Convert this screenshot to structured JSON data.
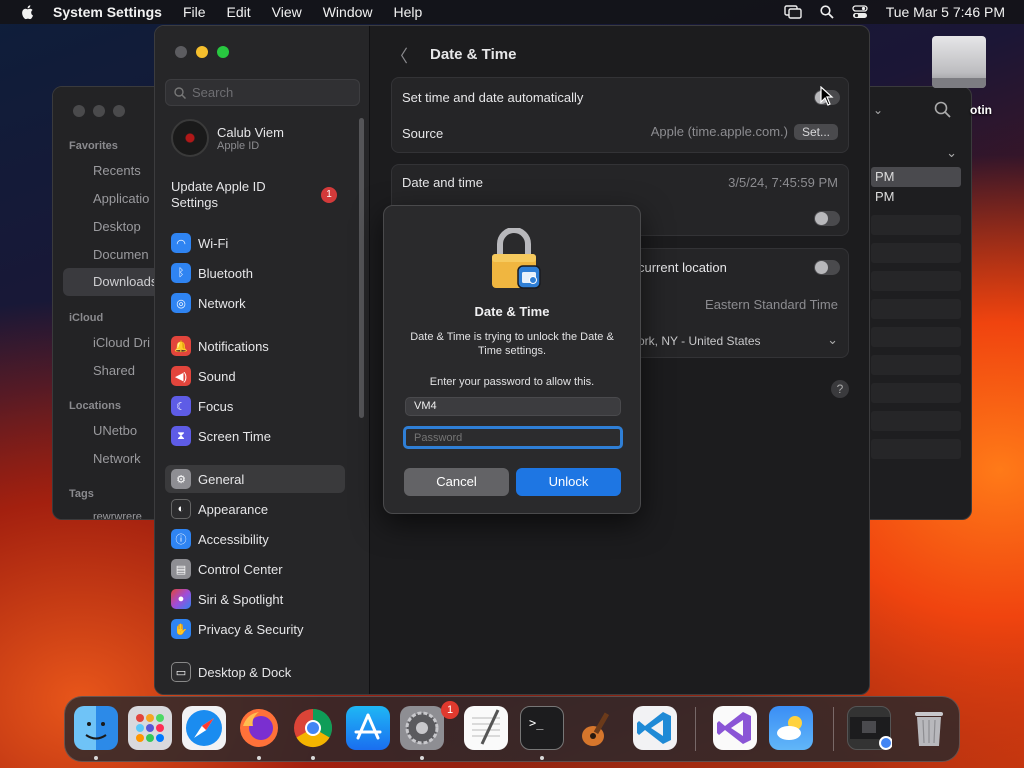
{
  "menubar": {
    "app": "System Settings",
    "menus": [
      "File",
      "Edit",
      "View",
      "Window",
      "Help"
    ],
    "clock": "Tue Mar 5  7:46 PM"
  },
  "finder": {
    "sections": [
      "Favorites",
      "iCloud",
      "Locations",
      "Tags"
    ],
    "favorites": [
      "Recents",
      "Applicatio",
      "Desktop",
      "Documen",
      "Downloads"
    ],
    "icloud": [
      "iCloud Dri",
      "Shared"
    ],
    "locations": [
      "UNetbo",
      "Network"
    ],
    "tags": [
      "rewrwrere"
    ],
    "rows": [
      "PM",
      "PM"
    ]
  },
  "desktop": {
    "drive_label": "otin"
  },
  "sidebar": {
    "search_placeholder": "Search",
    "account_name": "Calub Viem",
    "account_sub": "Apple ID",
    "update_label": "Update Apple ID Settings",
    "update_badge": "1",
    "items": [
      {
        "label": "Wi-Fi",
        "color": "#2f84f2"
      },
      {
        "label": "Bluetooth",
        "color": "#2f84f2"
      },
      {
        "label": "Network",
        "color": "#2f84f2"
      },
      {
        "label": "Notifications",
        "color": "#e2453c"
      },
      {
        "label": "Sound",
        "color": "#e2453c"
      },
      {
        "label": "Focus",
        "color": "#5e5ce6"
      },
      {
        "label": "Screen Time",
        "color": "#5e5ce6"
      },
      {
        "label": "General",
        "color": "#8e8e93"
      },
      {
        "label": "Appearance",
        "color": "#2b2b2d"
      },
      {
        "label": "Accessibility",
        "color": "#2f84f2"
      },
      {
        "label": "Control Center",
        "color": "#8e8e93"
      },
      {
        "label": "Siri & Spotlight",
        "color": "#a04cd8"
      },
      {
        "label": "Privacy & Security",
        "color": "#2f84f2"
      },
      {
        "label": "Desktop & Dock",
        "color": "#2b2b2d"
      }
    ]
  },
  "content": {
    "title": "Date & Time",
    "auto_label": "Set time and date automatically",
    "source_label": "Source",
    "source_value": "Apple (time.apple.com.)",
    "set_button": "Set...",
    "datetime_label": "Date and time",
    "datetime_value": "3/5/24, 7:45:59 PM",
    "location_label": "current location",
    "timezone_value": "Eastern Standard Time",
    "city_value": "ork, NY - United States",
    "help": "?"
  },
  "dialog": {
    "title": "Date & Time",
    "message": "Date & Time is trying to unlock the Date & Time settings.",
    "prompt": "Enter your password to allow this.",
    "username": "VM4",
    "password_placeholder": "Password",
    "cancel": "Cancel",
    "unlock": "Unlock"
  },
  "dock": {
    "settings_badge": "1",
    "apps": [
      "finder",
      "launchpad",
      "safari",
      "firefox",
      "chrome",
      "app-store",
      "system-settings",
      "textedit",
      "terminal",
      "garageband",
      "vscode",
      "visual-studio",
      "weather",
      "screenshot",
      "trash"
    ]
  }
}
